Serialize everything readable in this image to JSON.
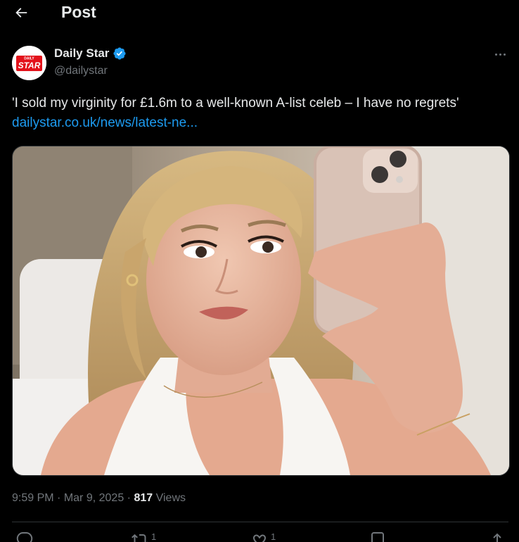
{
  "header": {
    "title": "Post",
    "back_icon": "arrow-left-icon"
  },
  "author": {
    "name": "Daily Star",
    "handle": "@dailystar",
    "verified": true,
    "avatar_text_small": "DAILY",
    "avatar_text_main": "STAR",
    "avatar_brand_color": "#e3121b",
    "verified_color": "#1d9bf0"
  },
  "post": {
    "text": "'I sold my virginity for £1.6m to a well-known A-list celeb – I have no regrets' ",
    "link_text": "dailystar.co.uk/news/latest-ne...",
    "link_color": "#1d9bf0"
  },
  "meta": {
    "time": "9:59 PM",
    "separator": "·",
    "date": "Mar 9, 2025",
    "separator2": "·",
    "views_count": "817",
    "views_label": " Views"
  },
  "actions": {
    "reply_count": "",
    "repost_count": "1",
    "like_count": "1",
    "bookmark_count": "",
    "share_icon": "share-icon"
  },
  "colors": {
    "background": "#000000",
    "text_primary": "#e7e9ea",
    "text_secondary": "#71767b",
    "border": "#2f3336"
  }
}
